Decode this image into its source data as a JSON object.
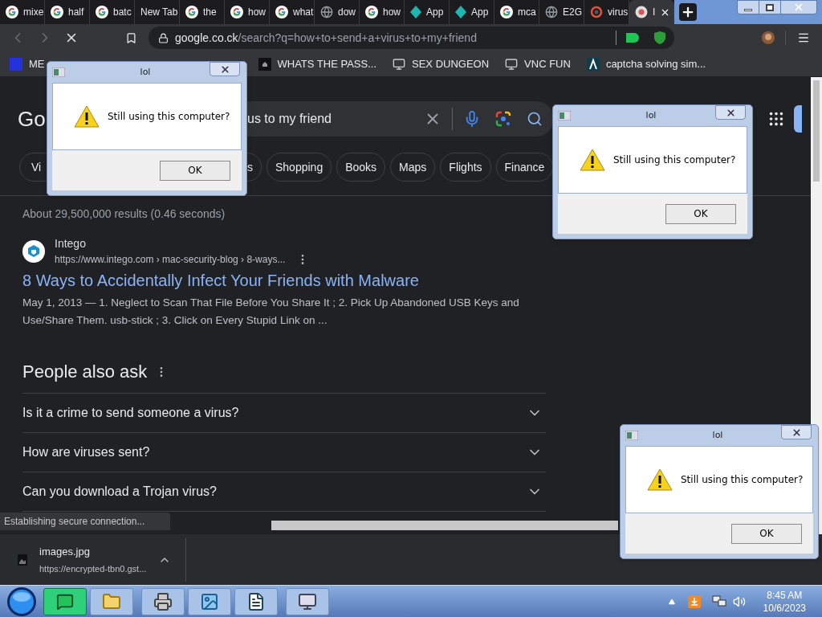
{
  "tabs": [
    {
      "title": "mixe",
      "kind": "google",
      "selected": false
    },
    {
      "title": "half",
      "kind": "google",
      "selected": false
    },
    {
      "title": "batc",
      "kind": "google",
      "selected": false
    },
    {
      "title": "New Tab",
      "kind": "blank",
      "selected": false
    },
    {
      "title": "the",
      "kind": "google",
      "selected": false
    },
    {
      "title": "how",
      "kind": "google",
      "selected": false
    },
    {
      "title": "what",
      "kind": "google",
      "selected": false
    },
    {
      "title": "dow",
      "kind": "globe",
      "selected": false
    },
    {
      "title": "how",
      "kind": "google",
      "selected": false
    },
    {
      "title": "App",
      "kind": "diamond",
      "selected": false
    },
    {
      "title": "App",
      "kind": "diamond",
      "selected": false
    },
    {
      "title": "mca",
      "kind": "google",
      "selected": false
    },
    {
      "title": "E2G",
      "kind": "globe",
      "selected": false
    },
    {
      "title": "virus",
      "kind": "ring",
      "selected": false
    },
    {
      "title": "I",
      "kind": "chrome",
      "selected": true
    }
  ],
  "address_bar": {
    "domain": "google.co.ck",
    "path": "/search?q=how+to+send+a+virus+to+my+friend"
  },
  "bookmarks": [
    {
      "label": "ME",
      "kind": "blue"
    },
    {
      "label": "WHATS THE PASS...",
      "kind": "dark"
    },
    {
      "label": "SEX DUNGEON",
      "kind": "computer"
    },
    {
      "label": "VNC FUN",
      "kind": "computer"
    },
    {
      "label": "captcha solving sim...",
      "kind": "lambda"
    }
  ],
  "search": {
    "logo": "Go",
    "query": "us to my friend"
  },
  "chips": [
    {
      "label": "Vi"
    },
    {
      "label": "s"
    },
    {
      "label": "Shopping"
    },
    {
      "label": "Books"
    },
    {
      "label": "Maps"
    },
    {
      "label": "Flights"
    },
    {
      "label": "Finance"
    }
  ],
  "result_stats": "About 29,500,000 results (0.46 seconds)",
  "result": {
    "site": "Intego",
    "url": "https://www.intego.com › mac-security-blog › 8-ways...",
    "title": "8 Ways to Accidentally Infect Your Friends with Malware",
    "snippet": "May 1, 2013 — 1. Neglect to Scan That File Before You Share It ; 2. Pick Up Abandoned USB Keys and Use/Share Them. usb-stick ; 3. Click on Every Stupid Link on ..."
  },
  "people_also_ask": {
    "heading": "People also ask",
    "questions": [
      "Is it a crime to send someone a virus?",
      "How are viruses sent?",
      "Can you download a Trojan virus?"
    ]
  },
  "status": "Establishing secure connection...",
  "download": {
    "file": "images.jpg",
    "url": "https://encrypted-tbn0.gst..."
  },
  "dialogs": [
    {
      "title": "lol",
      "message": "Still using this computer?",
      "button": "OK"
    },
    {
      "title": "lol",
      "message": "Still using this computer?",
      "button": "OK"
    },
    {
      "title": "lol",
      "message": "Still using this computer?",
      "button": "OK"
    }
  ],
  "taskbar": {
    "apps": [
      {
        "kind": "chat",
        "selected": true
      },
      {
        "kind": "folder",
        "selected": false
      },
      {
        "kind": "printer",
        "selected": false
      },
      {
        "kind": "picture",
        "selected": false
      },
      {
        "kind": "document",
        "selected": false
      },
      {
        "kind": "monitor",
        "selected": false
      }
    ],
    "time": "8:45 AM",
    "date": "10/6/2023"
  }
}
